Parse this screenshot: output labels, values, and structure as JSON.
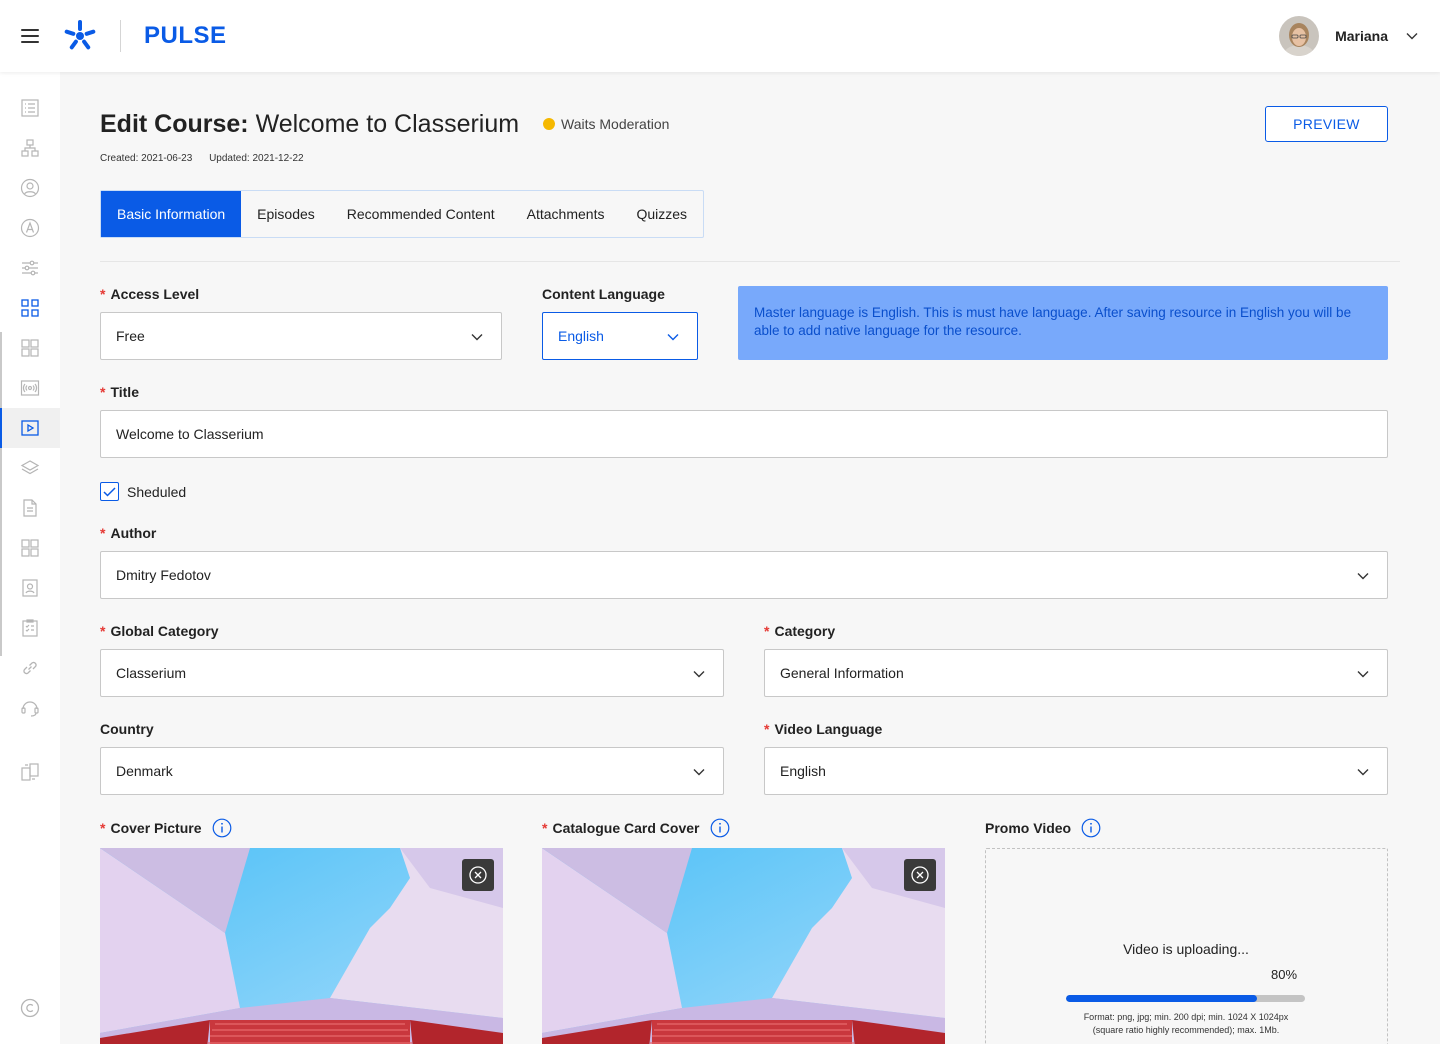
{
  "app": {
    "name": "PULSE",
    "brand_color": "#0a5be6"
  },
  "user": {
    "name": "Mariana"
  },
  "page": {
    "title_prefix": "Edit Course:",
    "title": "Welcome to Classerium",
    "status": "Waits Moderation",
    "status_color": "#f5b800",
    "created": "Created: 2021-06-23",
    "updated": "Updated: 2021-12-22",
    "preview_label": "PREVIEW"
  },
  "sidebar": {
    "items": [
      "list-icon",
      "hierarchy-icon",
      "user-icon",
      "account-icon",
      "sliders-icon",
      "apps-icon",
      "grid-icon",
      "broadcast-icon",
      "video-icon",
      "layers-icon",
      "document-icon",
      "blocks-icon",
      "contact-icon",
      "checklist-icon",
      "link-icon",
      "support-icon",
      "switch-icon",
      "copyright-icon"
    ],
    "active": "video-icon"
  },
  "tabs": [
    {
      "label": "Basic Information",
      "active": true
    },
    {
      "label": "Episodes",
      "active": false
    },
    {
      "label": "Recommended Content",
      "active": false
    },
    {
      "label": "Attachments",
      "active": false
    },
    {
      "label": "Quizzes",
      "active": false
    }
  ],
  "form": {
    "access_level": {
      "label": "Access Level",
      "value": "Free",
      "required": true
    },
    "content_language": {
      "label": "Content Language",
      "value": "English"
    },
    "language_notice": "Master language is English. This is must have language. After saving resource in English you will be able to add native language for the resource.",
    "title": {
      "label": "Title",
      "value": "Welcome to Classerium",
      "required": true
    },
    "scheduled": {
      "label": "Sheduled",
      "checked": true
    },
    "author": {
      "label": "Author",
      "value": "Dmitry Fedotov",
      "required": true
    },
    "global_category": {
      "label": "Global Category",
      "value": "Classerium",
      "required": true
    },
    "category": {
      "label": "Category",
      "value": "General Information",
      "required": true
    },
    "country": {
      "label": "Country",
      "value": "Denmark"
    },
    "video_language": {
      "label": "Video Language",
      "value": "English",
      "required": true
    },
    "cover_picture": {
      "label": "Cover Picture",
      "required": true
    },
    "catalogue_card_cover": {
      "label": "Catalogue Card Cover",
      "required": true
    },
    "promo_video": {
      "label": "Promo Video",
      "status": "Video is uploading...",
      "progress_text": "80%",
      "progress": 0.8,
      "hint_line1": "Format: png, jpg; min. 200 dpi; min. 1024 X 1024px",
      "hint_line2": "(square ratio highly recommended); max. 1Mb."
    }
  },
  "required_mark": "*"
}
